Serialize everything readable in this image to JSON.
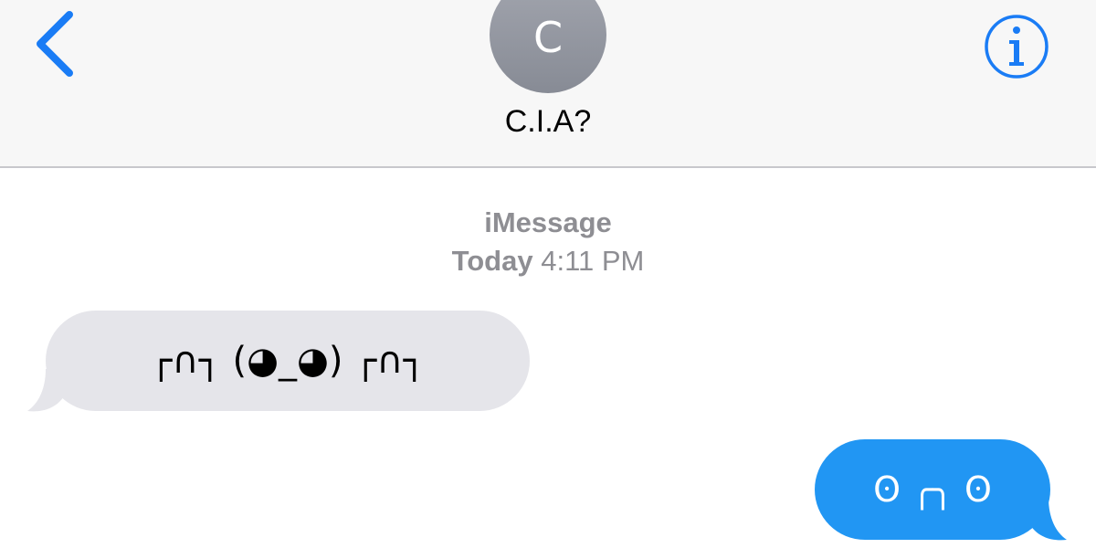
{
  "header": {
    "avatar_initial": "C",
    "contact_name": "C.I.A?",
    "accent_color": "#1a7cf5"
  },
  "conversation": {
    "service": "iMessage",
    "timestamp_day": "Today",
    "timestamp_time": "4:11 PM",
    "messages": [
      {
        "direction": "received",
        "text": "┌∩┐ (◕_◕) ┌∩┐",
        "bubble_color": "#e5e5ea"
      },
      {
        "direction": "sent",
        "text": "ʘ ╭╮ ʘ",
        "bubble_color": "#2196f3"
      }
    ]
  }
}
